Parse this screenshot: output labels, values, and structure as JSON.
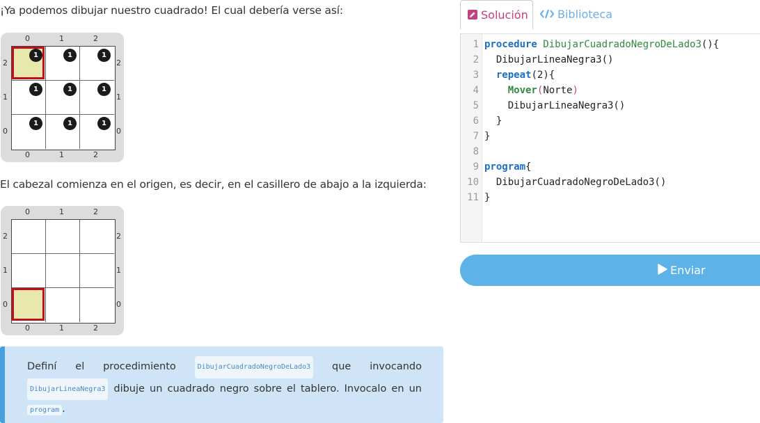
{
  "intro1": "¡Ya podemos dibujar nuestro cuadrado! El cual debería verse así:",
  "intro2": "El cabezal comienza en el origen, es decir, en el casillero de abajo a la izquierda:",
  "board": {
    "cols": [
      "0",
      "1",
      "2"
    ],
    "rows": [
      "2",
      "1",
      "0"
    ],
    "ball_count": "1"
  },
  "callout": {
    "w1": "Definí",
    "w2": "el",
    "w3": "procedimiento",
    "code1": "DibujarCuadradoNegroDeLado3",
    "w4": "que",
    "w5": "invocando",
    "code2": "DibujarLineaNegra3",
    "t2": "dibuje un cuadrado negro sobre el tablero. Invocalo en un",
    "code3": "program",
    "t3": "."
  },
  "tabs": {
    "solution": "Solución",
    "library": "Biblioteca"
  },
  "editor": {
    "line_numbers": [
      "1",
      "2",
      "3",
      "4",
      "5",
      "6",
      "7",
      "8",
      "9",
      "10",
      "11"
    ],
    "l1": {
      "kw": "procedure",
      "name": "DibujarCuadradoNegroDeLado3",
      "rest": "(){"
    },
    "l2": "  DibujarLineaNegra3()",
    "l3": {
      "indent": "  ",
      "kw": "repeat",
      "open": "(",
      "num": "2",
      "close": "){"
    },
    "l4": {
      "indent": "    ",
      "cmd": "Mover",
      "open": "(",
      "arg": "Norte",
      "close": ")"
    },
    "l5": "    DibujarLineaNegra3()",
    "l6": "  }",
    "l7": "}",
    "l9": {
      "kw": "program",
      "rest": "{"
    },
    "l10": "  DibujarCuadradoNegroDeLado3()",
    "l11": "}"
  },
  "send_label": "Enviar",
  "colors": {
    "accent": "#5db3e8",
    "solution_tab": "#c4407e",
    "head_border": "#c0101b",
    "head_fill": "#e9e8ac"
  }
}
